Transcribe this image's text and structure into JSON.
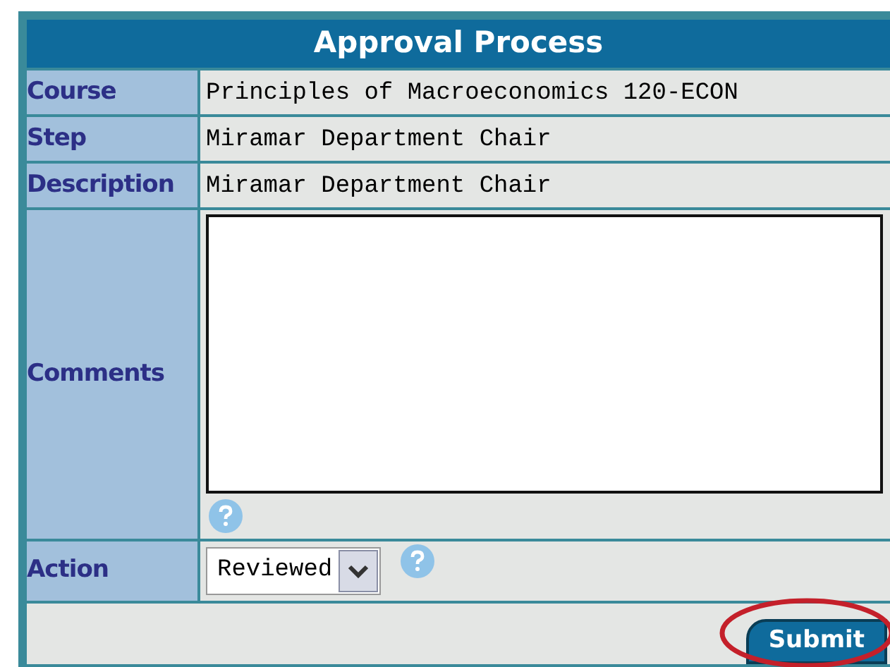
{
  "title": "Approval Process",
  "rows": [
    {
      "kind": "text",
      "label": "Course",
      "value": "Principles of Macroeconomics 120-ECON"
    },
    {
      "kind": "text",
      "label": "Step",
      "value": "Miramar Department Chair"
    },
    {
      "kind": "text",
      "label": "Description",
      "value": "Miramar Department Chair"
    },
    {
      "kind": "textarea",
      "label": "Comments"
    },
    {
      "kind": "select",
      "label": "Action",
      "value": "Reviewed"
    }
  ],
  "submit": {
    "label": "Submit",
    "highlighted": true
  }
}
